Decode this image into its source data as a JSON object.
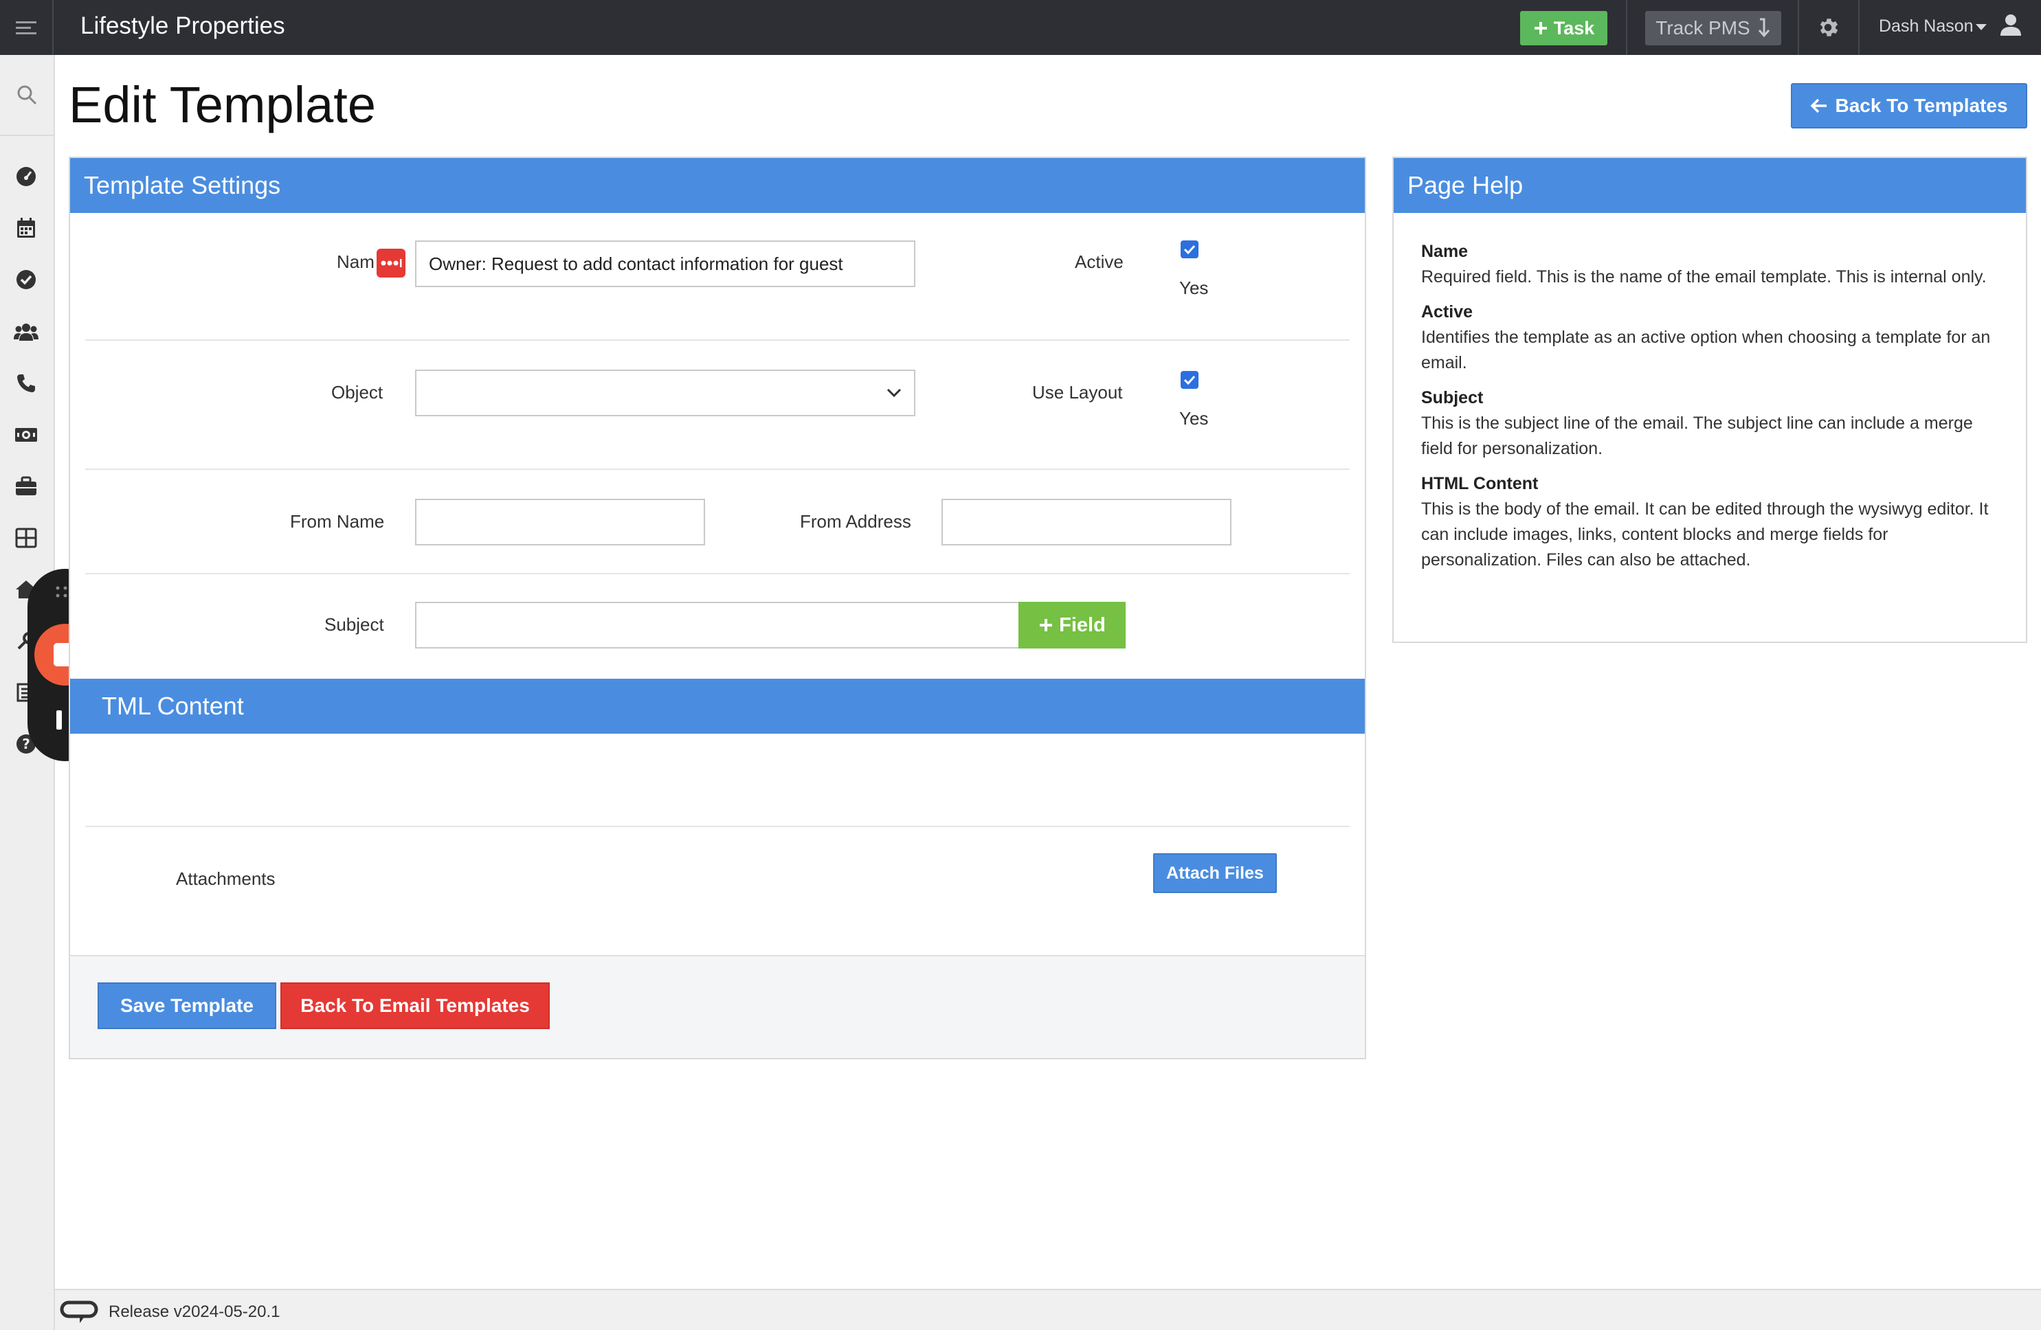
{
  "header": {
    "app_title": "Lifestyle Properties",
    "task_label": "Task",
    "track_label": "Track PMS",
    "user_name": "Dash Nason"
  },
  "page": {
    "title": "Edit Template",
    "back_to_templates_label": "Back To Templates"
  },
  "settings": {
    "header": "Template Settings",
    "name_label": "Nam",
    "name_value": "Owner: Request to add contact information for guest",
    "active_label": "Active",
    "active_yes": "Yes",
    "object_label": "Object",
    "object_value": "",
    "use_layout_label": "Use Layout",
    "use_layout_yes": "Yes",
    "from_name_label": "From Name",
    "from_name_value": "",
    "from_address_label": "From Address",
    "from_address_value": "",
    "subject_label": "Subject",
    "subject_value": "",
    "field_button_label": "Field",
    "html_header": "TML Content",
    "attachments_label": "Attachments",
    "attach_files_label": "Attach Files",
    "save_label": "Save Template",
    "back_email_label": "Back To Email Templates"
  },
  "help": {
    "header": "Page Help",
    "items": [
      {
        "term": "Name",
        "desc": "Required field. This is the name of the email template. This is internal only."
      },
      {
        "term": "Active",
        "desc": "Identifies the template as an active option when choosing a template for an email."
      },
      {
        "term": "Subject",
        "desc": "This is the subject line of the email. The subject line can include a merge field for personalization."
      },
      {
        "term": "HTML Content",
        "desc": "This is the body of the email. It can be edited through the wysiwyg editor. It can include images, links, content blocks and merge fields for personalization. Files can also be attached."
      }
    ]
  },
  "footer": {
    "release": "Release v2024-05-20.1"
  },
  "colors": {
    "primary": "#4a8de0",
    "success": "#76c043",
    "danger": "#e53935",
    "topbar": "#2d2f34"
  }
}
